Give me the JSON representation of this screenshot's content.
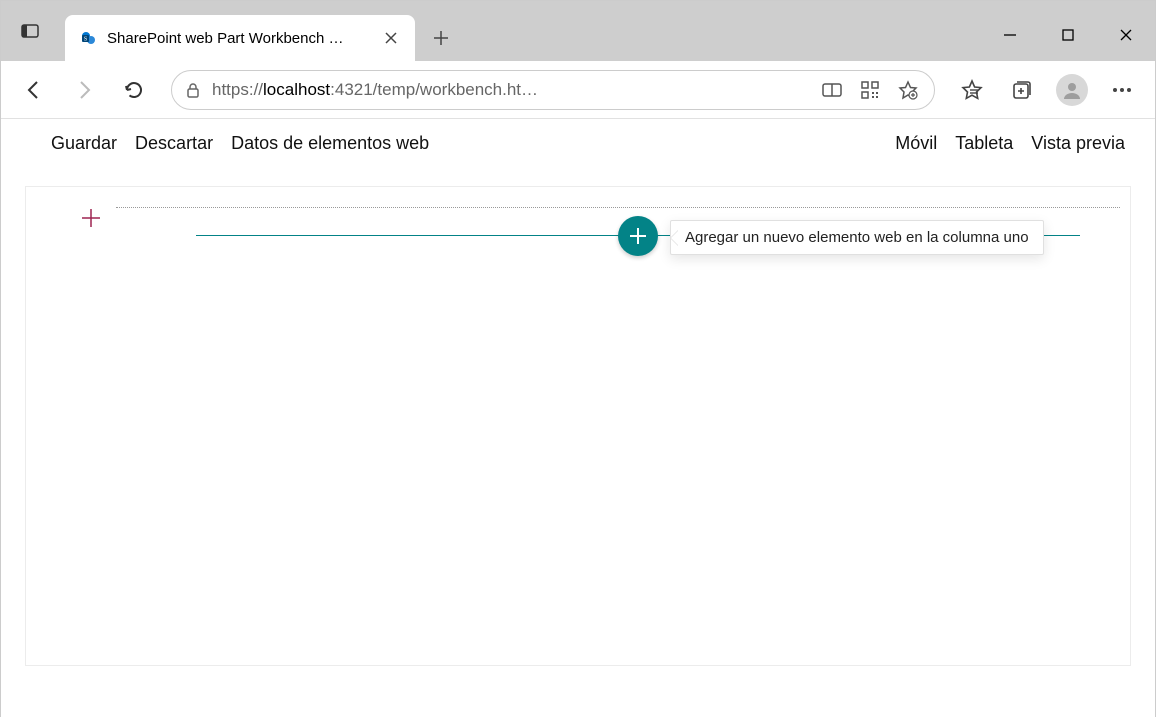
{
  "browser": {
    "tab_title": "SharePoint web Part Workbench …",
    "url_prefix": "https://",
    "url_host": "localhost",
    "url_rest": ":4321/temp/workbench.ht…"
  },
  "workbench": {
    "save": "Guardar",
    "discard": "Descartar",
    "webpart_data": "Datos de elementos web",
    "mobile": "Móvil",
    "tablet": "Tableta",
    "preview": "Vista previa",
    "add_webpart_tooltip": "Agregar un nuevo elemento web en la columna uno"
  }
}
